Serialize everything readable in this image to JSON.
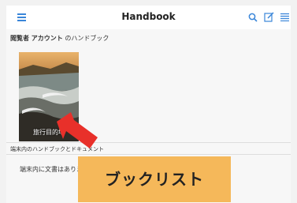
{
  "header": {
    "title": "Handbook",
    "menu_icon": "hamburger-menu-icon",
    "search_icon": "search-icon",
    "edit_icon": "edit-icon",
    "list_icon": "list-icon"
  },
  "main": {
    "section_user": "閲覧者 アカウント",
    "section_suffix": " のハンドブック",
    "book": {
      "title": "旅行目的地"
    },
    "local_section": "端末内のハンドブックとドキュメント",
    "empty_text": "端末内に文書はありま"
  },
  "callout": {
    "label": "ブックリスト",
    "color": "#f5b85a"
  },
  "colors": {
    "accent": "#3a86d9",
    "arrow": "#e8302a"
  }
}
